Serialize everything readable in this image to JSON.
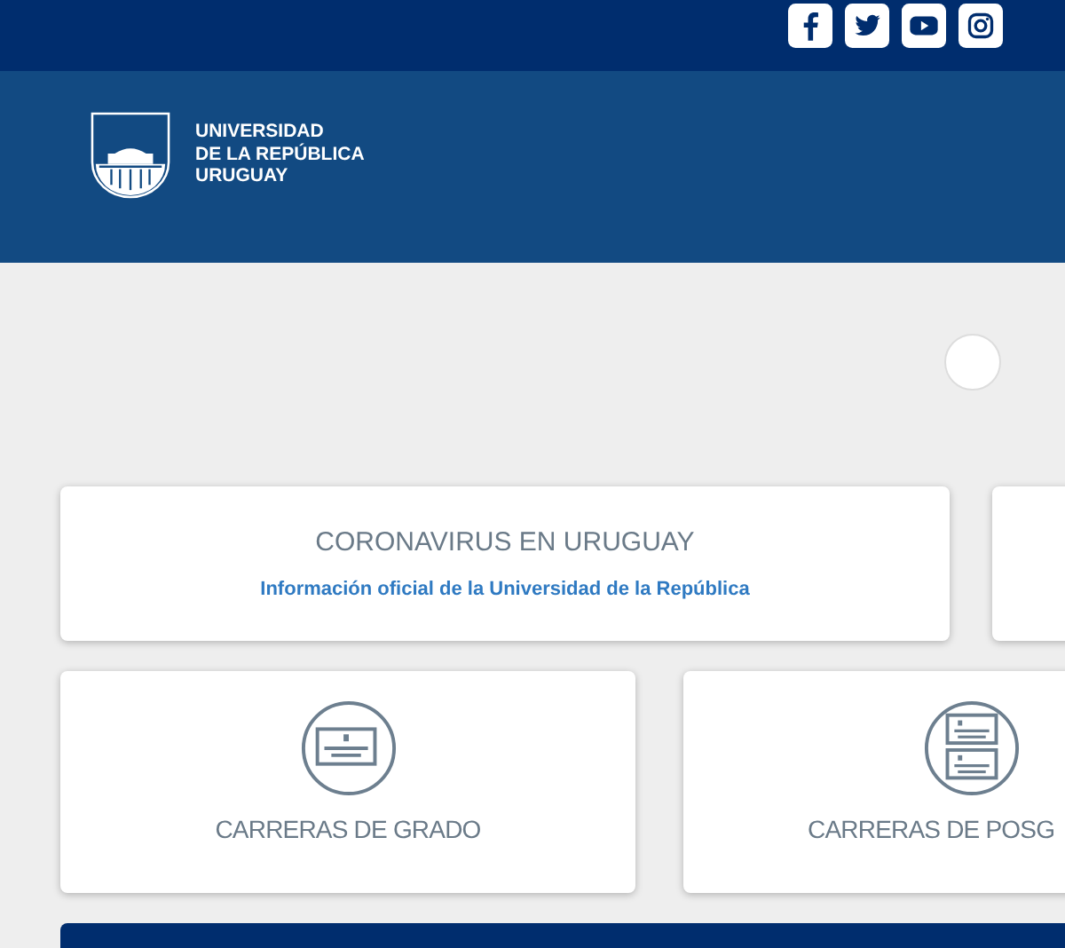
{
  "logo": {
    "lines": [
      "UNIVERSIDAD",
      "DE LA REPÚBLICA",
      "URUGUAY"
    ]
  },
  "featured_card": {
    "title": "CORONAVIRUS EN URUGUAY",
    "link": "Información oficial de la Universidad de la República"
  },
  "cards": [
    {
      "kind": "single",
      "label": "CARRERAS DE GRADO"
    },
    {
      "kind": "double",
      "label": "CARRERAS DE POSG"
    }
  ]
}
